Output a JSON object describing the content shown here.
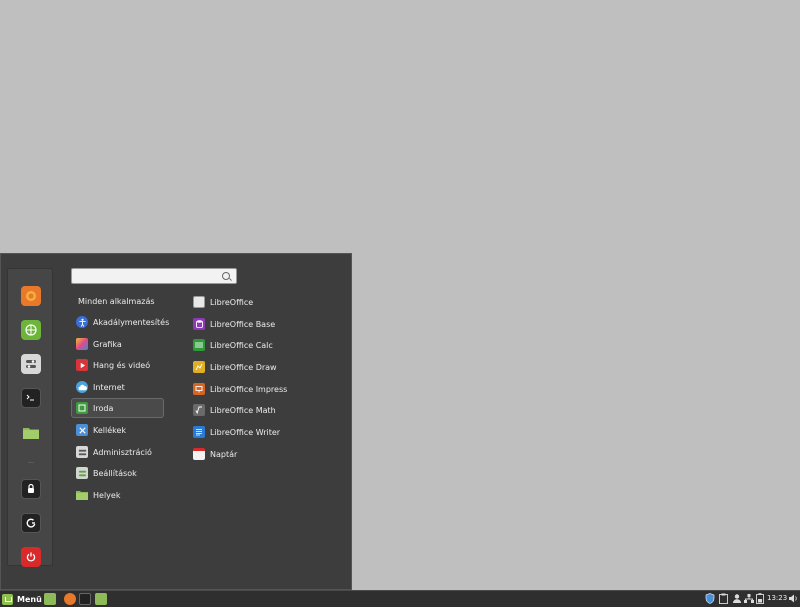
{
  "search": {
    "placeholder": "",
    "value": ""
  },
  "all_apps_label": "Minden alkalmazás",
  "categories": [
    {
      "label": "Akadálymentesítés",
      "icon": "accessibility-icon",
      "color": "#3a6fd8"
    },
    {
      "label": "Grafika",
      "icon": "graphics-icon",
      "color": "#e04a8a"
    },
    {
      "label": "Hang és videó",
      "icon": "multimedia-icon",
      "color": "#d8343c"
    },
    {
      "label": "Internet",
      "icon": "cloud-icon",
      "color": "#4aa3df"
    },
    {
      "label": "Iroda",
      "icon": "office-icon",
      "color": "#3d9a3d"
    },
    {
      "label": "Kellékek",
      "icon": "accessories-icon",
      "color": "#4a8fd8"
    },
    {
      "label": "Adminisztráció",
      "icon": "administration-icon",
      "color": "#d8d8d8"
    },
    {
      "label": "Beállítások",
      "icon": "settings-icon",
      "color": "#cfd8cf"
    },
    {
      "label": "Helyek",
      "icon": "folder-icon",
      "color": "#8fba5a"
    }
  ],
  "selected_category": "Iroda",
  "apps": [
    {
      "label": "LibreOffice",
      "icon": "libreoffice-icon",
      "color": "#e8e8e8"
    },
    {
      "label": "LibreOffice Base",
      "icon": "libreoffice-base-icon",
      "color": "#8e3ab8"
    },
    {
      "label": "LibreOffice Calc",
      "icon": "libreoffice-calc-icon",
      "color": "#2e9a3a"
    },
    {
      "label": "LibreOffice Draw",
      "icon": "libreoffice-draw-icon",
      "color": "#e0b020"
    },
    {
      "label": "LibreOffice Impress",
      "icon": "libreoffice-impress-icon",
      "color": "#d86420"
    },
    {
      "label": "LibreOffice Math",
      "icon": "libreoffice-math-icon",
      "color": "#6a6a6a"
    },
    {
      "label": "LibreOffice Writer",
      "icon": "libreoffice-writer-icon",
      "color": "#2a7ad8"
    },
    {
      "label": "Naptár",
      "icon": "calendar-icon",
      "color": "#f2f2f2"
    }
  ],
  "favorites": [
    {
      "name": "firefox-icon",
      "color": "#e8782a"
    },
    {
      "name": "software-manager-icon",
      "color": "#6cb43a"
    },
    {
      "name": "system-settings-icon",
      "color": "#d8d8d8"
    },
    {
      "name": "terminal-icon",
      "color": "#222222"
    },
    {
      "name": "files-folder-icon",
      "color": "#8fba5a"
    },
    {
      "name": "lock-screen-icon",
      "color": "#222222"
    },
    {
      "name": "logout-icon",
      "color": "#222222"
    },
    {
      "name": "shutdown-icon",
      "color": "#d82a2a"
    }
  ],
  "taskbar": {
    "menu_label": "Menü",
    "clock": "13:23"
  },
  "colors": {
    "accent": "#8fc14f",
    "panel": "#3d3d3d",
    "desktop": "#bfbfbf"
  }
}
